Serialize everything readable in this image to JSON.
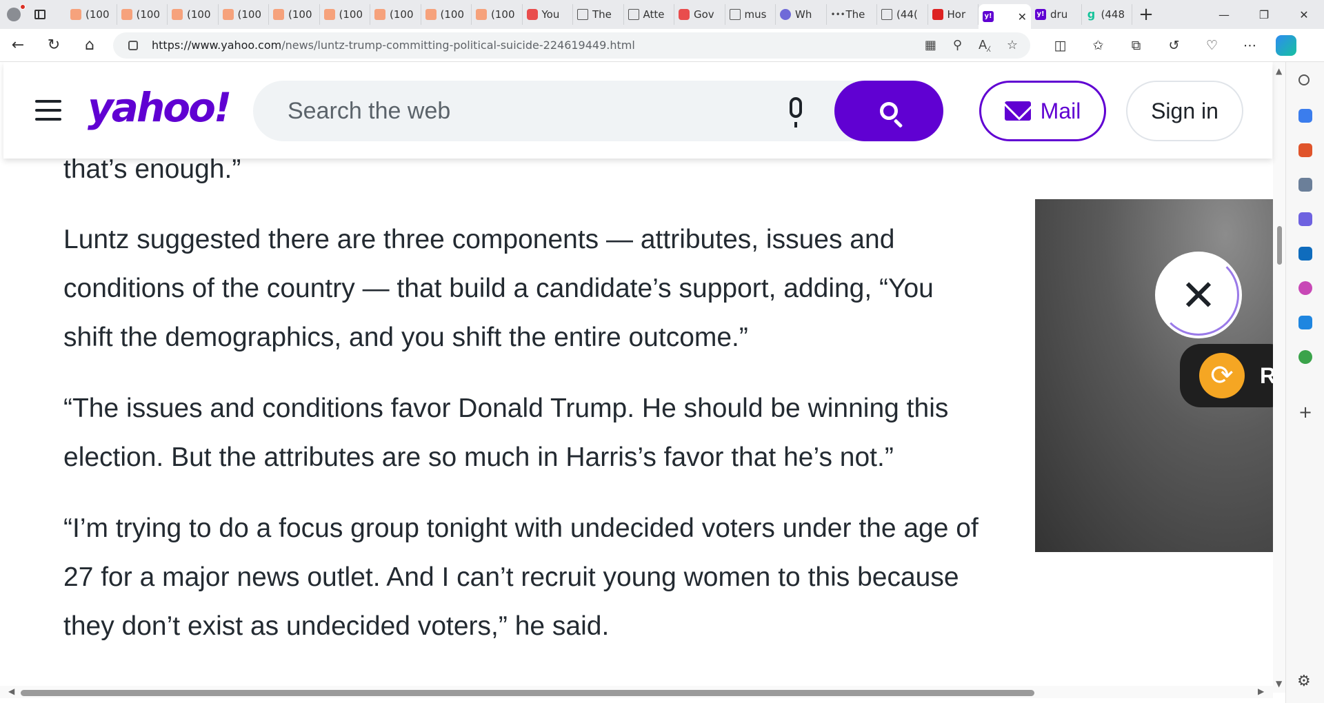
{
  "browser": {
    "tabs": [
      {
        "label": "(100",
        "icon": "substack-icon"
      },
      {
        "label": "(100",
        "icon": "substack-icon"
      },
      {
        "label": "(100",
        "icon": "substack-icon"
      },
      {
        "label": "(100",
        "icon": "substack-icon"
      },
      {
        "label": "(100",
        "icon": "substack-icon"
      },
      {
        "label": "(100",
        "icon": "substack-icon"
      },
      {
        "label": "(100",
        "icon": "substack-icon"
      },
      {
        "label": "(100",
        "icon": "substack-icon"
      },
      {
        "label": "(100",
        "icon": "substack-icon"
      },
      {
        "label": "You",
        "icon": "youtube-icon"
      },
      {
        "label": "The",
        "icon": "document-icon"
      },
      {
        "label": "Atte",
        "icon": "document-icon"
      },
      {
        "label": "Gov",
        "icon": "youtube-icon"
      },
      {
        "label": "mus",
        "icon": "document-icon"
      },
      {
        "label": "Wh",
        "icon": "vpn-icon"
      },
      {
        "label": "The",
        "icon": "dots-icon"
      },
      {
        "label": "(44(",
        "icon": "document-icon"
      },
      {
        "label": "Hor",
        "icon": "red-icon"
      },
      {
        "label": "",
        "icon": "yahoo-icon",
        "active": true
      },
      {
        "label": "dru",
        "icon": "yahoo-icon"
      },
      {
        "label": "(448",
        "icon": "grammarly-icon"
      }
    ],
    "url_host": "https://www.yahoo.com",
    "url_path": "/news/luntz-trump-committing-political-suicide-224619449.html"
  },
  "header": {
    "logo_text": "yahoo!",
    "search_placeholder": "Search the web",
    "mail_label": "Mail",
    "signin_label": "Sign in"
  },
  "article": {
    "paragraphs": [
      "that’s enough.”",
      "Luntz suggested there are three components — attributes, issues and conditions of the country — that build a candidate’s support, adding, “You shift the demographics, and you shift the entire outcome.”",
      "“The issues and conditions favor Donald Trump. He should be winning this election. But the attributes are so much in Harris’s favor that he’s not.”",
      "“I’m trying to do a focus group tonight with undecided voters under the age of 27 for a major news outlet. And I can’t recruit young women to this because they don’t exist as undecided voters,” he said."
    ]
  },
  "ad": {
    "replay_label": "R"
  },
  "colors": {
    "brand": "#6001d2",
    "text": "#232a31"
  }
}
